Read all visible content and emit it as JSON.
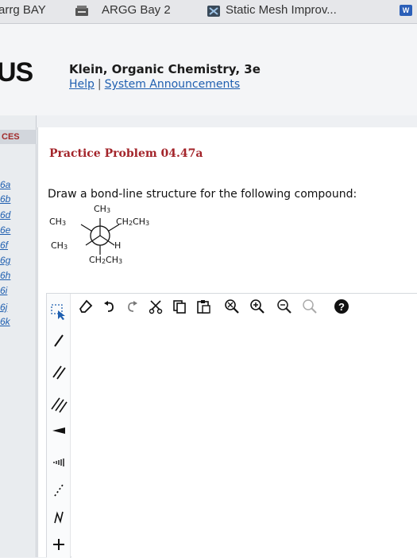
{
  "bookmarks": {
    "item1": "arrg BAY",
    "item2": "ARGG Bay 2",
    "item3": "Static Mesh Improv...",
    "ext_badge": "W"
  },
  "header": {
    "logo": "US",
    "book_title": "Klein, Organic Chemistry, 3e",
    "help_link": "Help",
    "separator": "|",
    "announcements_link": "System Announcements"
  },
  "leftnav": {
    "heading": "CES",
    "links": [
      "6a",
      "6b",
      "6d",
      "6e",
      "6f",
      "6g",
      "6h",
      "6i",
      "6j",
      "6k"
    ]
  },
  "problem": {
    "title": "Practice Problem 04.47a",
    "instruction": "Draw a bond-line structure for the following compound:"
  },
  "newman": {
    "top": "CH3",
    "upper_left": "CH3",
    "upper_right": "CH2CH3",
    "lower_left": "CH3",
    "lower_right": "H",
    "bottom": "CH2CH3"
  },
  "editor": {
    "left_tools": [
      "select-tool",
      "single-bond-tool",
      "double-bond-tool",
      "triple-bond-tool",
      "wedge-bond-tool",
      "hash-bond-tool",
      "dashed-bond-tool",
      "chain-tool",
      "charge-tool"
    ],
    "top_tools": [
      "eraser-tool",
      "undo-tool",
      "redo-tool",
      "cut-tool",
      "copy-tool",
      "paste-tool",
      "zoom-fit-tool",
      "zoom-in-tool",
      "zoom-out-tool",
      "clean-tool",
      "help-tool"
    ]
  }
}
